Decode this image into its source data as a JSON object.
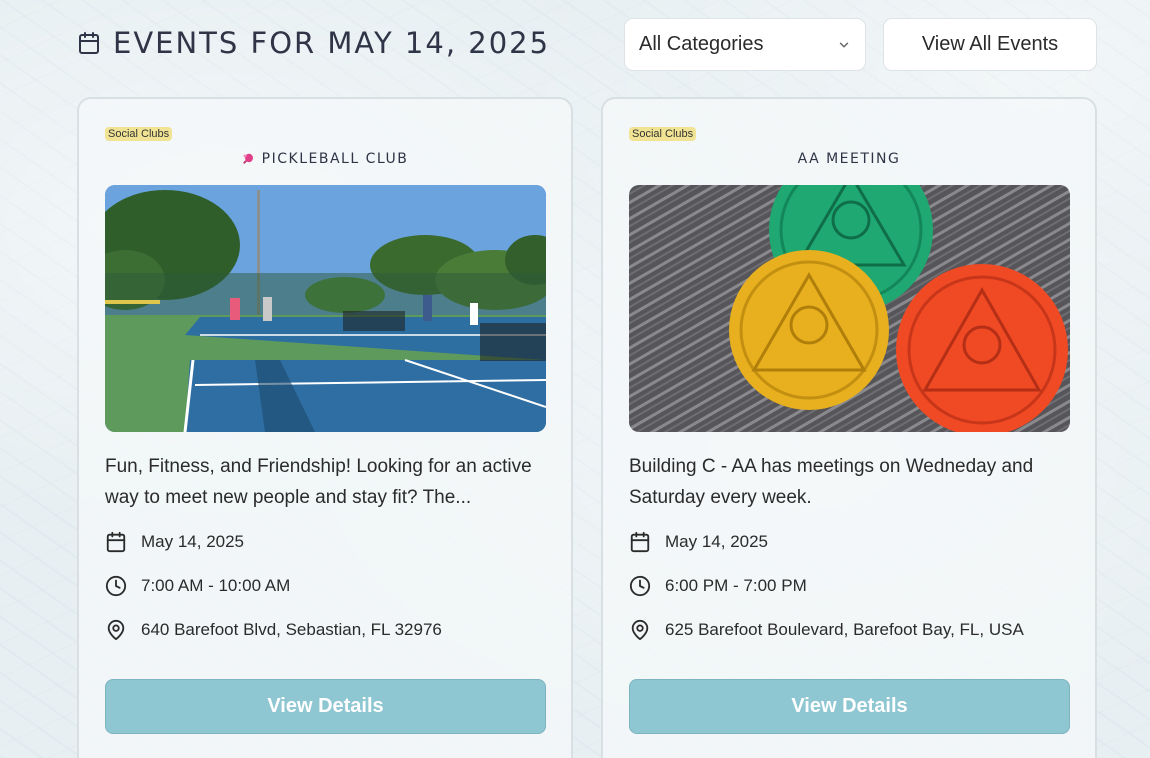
{
  "header": {
    "title": "Events for May 14, 2025",
    "title_icon": "calendar-icon",
    "category_select": {
      "selected": "All Categories",
      "icon": "chevron-down-icon"
    },
    "view_all_label": "View All Events"
  },
  "events": [
    {
      "category": "Social Clubs",
      "title": "Pickleball Club",
      "title_icon": "pickleball-paddle-icon",
      "image": "pickleball-courts-photo",
      "description": "Fun, Fitness, and Friendship! Looking for an active way to meet new people and stay fit? The...",
      "date": "May 14, 2025",
      "time": "7:00 AM - 10:00 AM",
      "location": "640 Barefoot Blvd, Sebastian, FL 32976",
      "button_label": "View Details"
    },
    {
      "category": "Social Clubs",
      "title": "AA Meeting",
      "image": "recovery-coins-photo",
      "description": "Building C - AA has meetings on Wedneday and Saturday every week.",
      "date": "May 14, 2025",
      "time": "6:00 PM - 7:00 PM",
      "location": "625 Barefoot Boulevard, Barefoot Bay, FL, USA",
      "button_label": "View Details"
    }
  ],
  "colors": {
    "badge": "#f1e394",
    "button": "#8ec6d2",
    "title_text": "#2f3547"
  }
}
